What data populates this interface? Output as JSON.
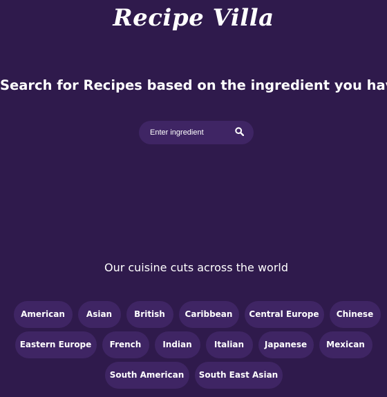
{
  "brand": {
    "title": "Recipe Villa"
  },
  "hero": {
    "headline": "Search for Recipes based on the ingredient you have"
  },
  "search": {
    "placeholder": "Enter ingredient",
    "icon": "search-icon"
  },
  "cuisines": {
    "heading": "Our cuisine cuts across the world",
    "rows": [
      [
        {
          "label": "American"
        },
        {
          "label": "Asian"
        },
        {
          "label": "British"
        },
        {
          "label": "Caribbean"
        },
        {
          "label": "Central Europe"
        },
        {
          "label": "Chinese"
        }
      ],
      [
        {
          "label": "Eastern Europe"
        },
        {
          "label": "French"
        },
        {
          "label": "Indian"
        },
        {
          "label": "Italian"
        },
        {
          "label": "Japanese"
        },
        {
          "label": "Mexican"
        }
      ],
      [
        {
          "label": "South American"
        },
        {
          "label": "South East Asian"
        }
      ]
    ]
  },
  "colors": {
    "background": "#2f1a4c",
    "chip": "#3f2564",
    "text": "#ffffff"
  }
}
